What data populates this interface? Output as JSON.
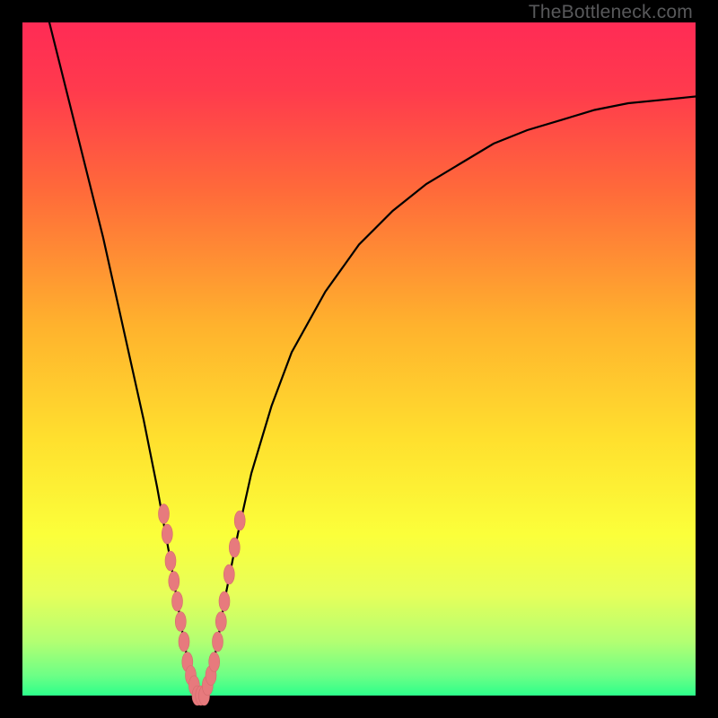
{
  "watermark": "TheBottleneck.com",
  "colors": {
    "gradient_stops": [
      {
        "offset": 0.0,
        "color": "#ff2b55"
      },
      {
        "offset": 0.1,
        "color": "#ff3a4d"
      },
      {
        "offset": 0.25,
        "color": "#ff6a3a"
      },
      {
        "offset": 0.45,
        "color": "#ffb22d"
      },
      {
        "offset": 0.62,
        "color": "#ffe02e"
      },
      {
        "offset": 0.76,
        "color": "#fbff3a"
      },
      {
        "offset": 0.85,
        "color": "#e6ff5a"
      },
      {
        "offset": 0.92,
        "color": "#b3ff72"
      },
      {
        "offset": 0.97,
        "color": "#6dff86"
      },
      {
        "offset": 1.0,
        "color": "#2dff8a"
      }
    ],
    "curve": "#000000",
    "marker_fill": "#e77a7d",
    "marker_stroke": "#d46a6d",
    "background": "#000000"
  },
  "chart_data": {
    "type": "line",
    "title": "",
    "xlabel": "",
    "ylabel": "",
    "xlim": [
      0,
      100
    ],
    "ylim": [
      0,
      100
    ],
    "grid": false,
    "legend": "none",
    "series": [
      {
        "name": "bottleneck-curve",
        "x": [
          4,
          6,
          8,
          10,
          12,
          14,
          16,
          18,
          20,
          22,
          23,
          24,
          25,
          26,
          27,
          28,
          29,
          30,
          32,
          34,
          37,
          40,
          45,
          50,
          55,
          60,
          65,
          70,
          75,
          80,
          85,
          90,
          95,
          100
        ],
        "y": [
          100,
          92,
          84,
          76,
          68,
          59,
          50,
          41,
          31,
          20,
          14,
          8,
          3,
          0,
          0,
          3,
          8,
          14,
          24,
          33,
          43,
          51,
          60,
          67,
          72,
          76,
          79,
          82,
          84,
          85.5,
          87,
          88,
          88.5,
          89
        ]
      }
    ],
    "minimum_x": 26,
    "minimum_y": 0,
    "markers": {
      "name": "highlighted-points",
      "points": [
        {
          "x": 21.0,
          "y": 27
        },
        {
          "x": 21.5,
          "y": 24
        },
        {
          "x": 22.0,
          "y": 20
        },
        {
          "x": 22.5,
          "y": 17
        },
        {
          "x": 23.0,
          "y": 14
        },
        {
          "x": 23.5,
          "y": 11
        },
        {
          "x": 24.0,
          "y": 8
        },
        {
          "x": 24.5,
          "y": 5
        },
        {
          "x": 25.0,
          "y": 3
        },
        {
          "x": 25.5,
          "y": 1.5
        },
        {
          "x": 26.0,
          "y": 0
        },
        {
          "x": 26.5,
          "y": 0
        },
        {
          "x": 27.0,
          "y": 0
        },
        {
          "x": 27.5,
          "y": 1.5
        },
        {
          "x": 28.0,
          "y": 3
        },
        {
          "x": 28.5,
          "y": 5
        },
        {
          "x": 29.0,
          "y": 8
        },
        {
          "x": 29.5,
          "y": 11
        },
        {
          "x": 30.0,
          "y": 14
        },
        {
          "x": 30.7,
          "y": 18
        },
        {
          "x": 31.5,
          "y": 22
        },
        {
          "x": 32.3,
          "y": 26
        }
      ]
    }
  }
}
